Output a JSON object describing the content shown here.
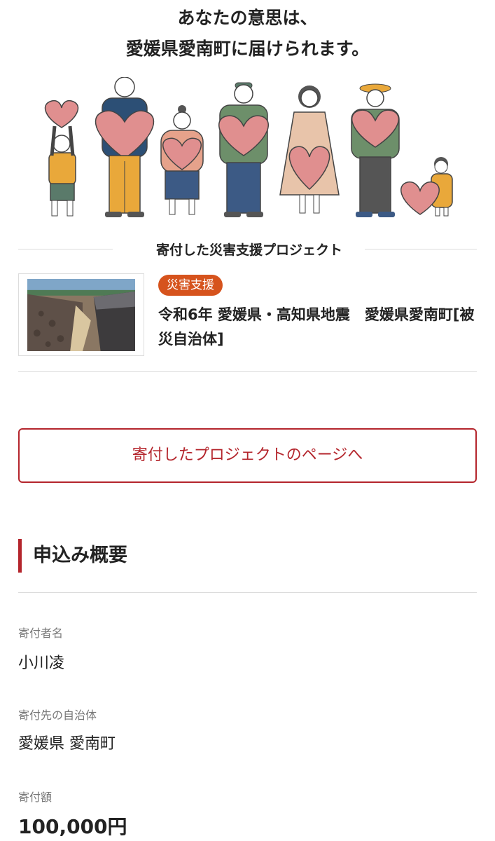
{
  "headline": {
    "line1": "あなたの意思は、",
    "line2": "愛媛県愛南町に届けられます。"
  },
  "project_section": {
    "title": "寄付した災害支援プロジェクト",
    "card": {
      "badge": "災害支援",
      "title": "令和6年 愛媛県・高知県地震　愛媛県愛南町[被災自治体]"
    }
  },
  "project_button_label": "寄付したプロジェクトのページへ",
  "summary": {
    "heading": "申込み概要",
    "fields": [
      {
        "label": "寄付者名",
        "value": "小川凌"
      },
      {
        "label": "寄付先の自治体",
        "value": "愛媛県 愛南町"
      },
      {
        "label": "寄付額",
        "value": "100,000円"
      }
    ]
  },
  "colors": {
    "accent": "#b4252c",
    "badge": "#d6531d",
    "heart": "#e08f8f"
  }
}
